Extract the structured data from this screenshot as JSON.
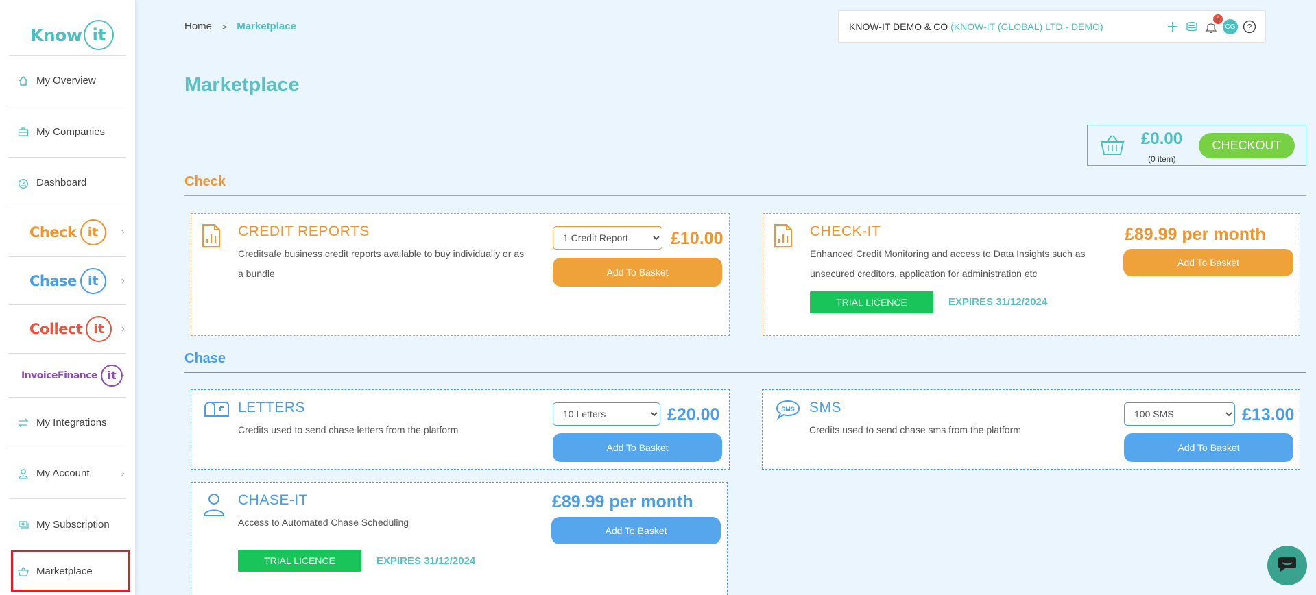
{
  "sidebar": {
    "logo": {
      "text": "Know",
      "circle": "it"
    },
    "items": [
      {
        "label": "My Overview",
        "icon": "home-icon"
      },
      {
        "label": "My Companies",
        "icon": "briefcase-icon"
      },
      {
        "label": "Dashboard",
        "icon": "dashboard-icon"
      },
      {
        "label": "My Integrations",
        "icon": "arrows-icon"
      },
      {
        "label": "My Account",
        "icon": "user-icon"
      },
      {
        "label": "My Subscription",
        "icon": "money-icon"
      },
      {
        "label": "Marketplace",
        "icon": "basket-icon"
      }
    ],
    "brands": [
      {
        "text": "Check",
        "circle": "it",
        "color": "#f0962e"
      },
      {
        "text": "Chase",
        "circle": "it",
        "color": "#4a9ee6"
      },
      {
        "text": "Collect",
        "circle": "it",
        "color": "#e8553e"
      },
      {
        "text": "InvoiceFinance",
        "circle": "it",
        "color": "#8b4fb0"
      }
    ]
  },
  "breadcrumb": {
    "home": "Home",
    "separator": ">",
    "current": "Marketplace"
  },
  "topbar": {
    "company": "KNOW-IT DEMO & CO",
    "org": "(KNOW-IT (GLOBAL) LTD - DEMO)",
    "notification_count": "6",
    "avatar_initials": "CG"
  },
  "page_title": "Marketplace",
  "basket": {
    "total": "£0.00",
    "count": "(0 item)",
    "checkout_label": "CHECKOUT"
  },
  "sections": {
    "check": {
      "title": "Check",
      "color": "#f0962e"
    },
    "chase": {
      "title": "Chase",
      "color": "#4a9ee6"
    }
  },
  "products": {
    "credit_reports": {
      "title": "CREDIT REPORTS",
      "desc_line1": "Creditsafe business credit reports available to buy individually or as",
      "desc_line2": "a bundle",
      "option": "1 Credit Report",
      "price": "£10.00",
      "button": "Add To Basket"
    },
    "check_it": {
      "title": "CHECK-IT",
      "desc_line1": "Enhanced Credit Monitoring and access to Data Insights such as",
      "desc_line2": "unsecured creditors, application for administration etc",
      "price": "£89.99 per month",
      "button": "Add To Basket",
      "trial": "TRIAL LICENCE",
      "expires": "EXPIRES 31/12/2024"
    },
    "letters": {
      "title": "LETTERS",
      "desc": "Credits used to send chase letters from the platform",
      "option": "10 Letters",
      "price": "£20.00",
      "button": "Add To Basket"
    },
    "sms": {
      "title": "SMS",
      "desc": "Credits used to send chase sms from the platform",
      "option": "100 SMS",
      "price": "£13.00",
      "button": "Add To Basket"
    },
    "chase_it": {
      "title": "CHASE-IT",
      "desc": "Access to Automated Chase Scheduling",
      "price": "£89.99 per month",
      "button": "Add To Basket",
      "trial": "TRIAL LICENCE",
      "expires": "EXPIRES 31/12/2024"
    }
  }
}
